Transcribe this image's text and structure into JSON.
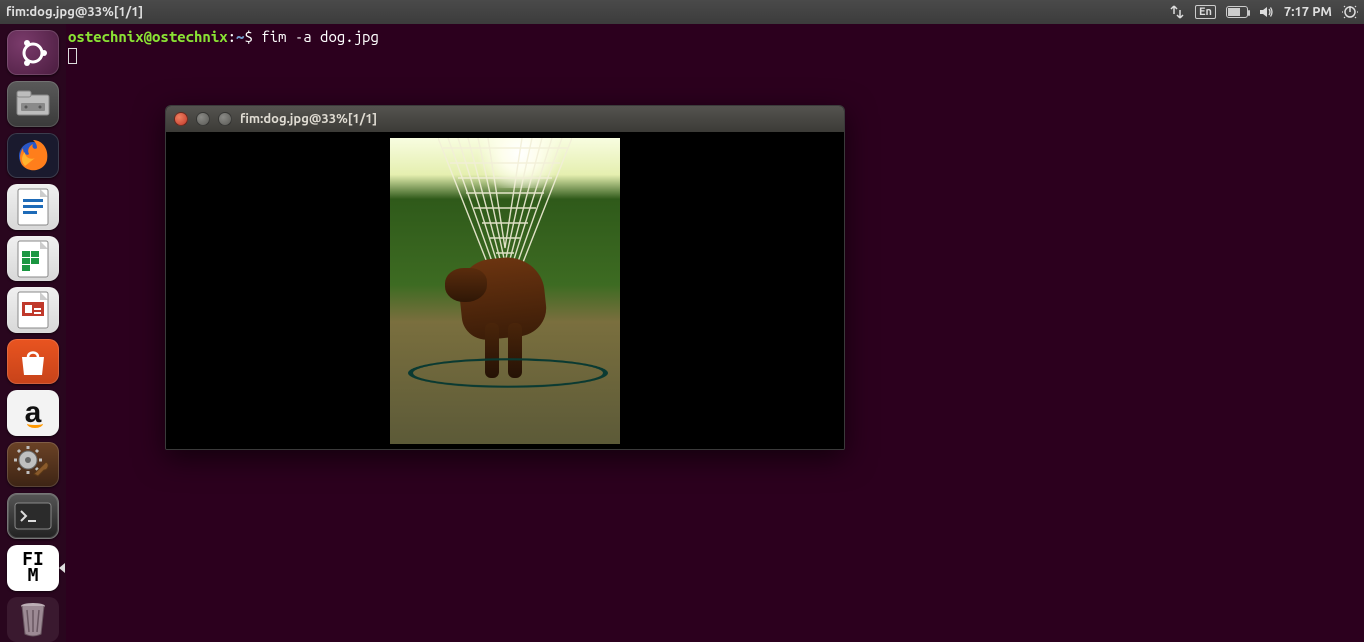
{
  "menubar": {
    "title": "fim:dog.jpg@33%[1/1]",
    "language": "En",
    "time": "7:17 PM"
  },
  "launcher": {
    "items": [
      {
        "name": "ubuntu-dash",
        "label": "Dash"
      },
      {
        "name": "files",
        "label": "Files"
      },
      {
        "name": "firefox",
        "label": "Firefox"
      },
      {
        "name": "libreoffice-writer",
        "label": "Writer"
      },
      {
        "name": "libreoffice-calc",
        "label": "Calc"
      },
      {
        "name": "libreoffice-impress",
        "label": "Impress"
      },
      {
        "name": "ubuntu-software",
        "label": "Software"
      },
      {
        "name": "amazon",
        "label": "Amazon"
      },
      {
        "name": "system-settings",
        "label": "Settings"
      },
      {
        "name": "terminal",
        "label": "Terminal"
      },
      {
        "name": "fim",
        "label": "FIM"
      },
      {
        "name": "trash",
        "label": "Trash"
      }
    ],
    "fim_text_top": "FI",
    "fim_text_bottom": "M",
    "amazon_glyph": "a"
  },
  "terminal": {
    "user": "ostechnix",
    "at": "@",
    "host": "ostechnix",
    "colon": ":",
    "path": "~",
    "dollar": "$ ",
    "command": "fim -a dog.jpg"
  },
  "fim_window": {
    "title": "fim:dog.jpg@33%[1/1]"
  }
}
